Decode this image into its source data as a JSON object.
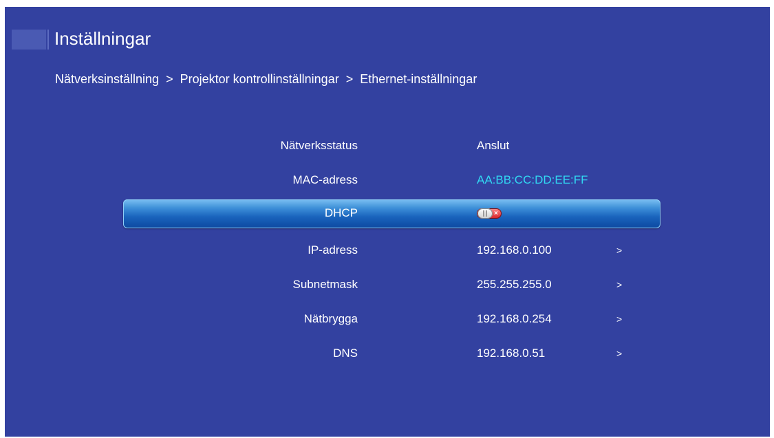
{
  "header": {
    "title": "Inställningar",
    "logo_icon": "app-logo-icon"
  },
  "breadcrumb": {
    "items": [
      "Nätverksinställning",
      "Projektor kontrollinställningar",
      "Ethernet-inställningar"
    ],
    "separator": ">"
  },
  "settings": {
    "network_status": {
      "label": "Nätverksstatus",
      "value": "Anslut"
    },
    "mac_address": {
      "label": "MAC-adress",
      "value": "AA:BB:CC:DD:EE:FF"
    },
    "dhcp": {
      "label": "DHCP",
      "state": "off",
      "toggle_off_glyph": "×"
    },
    "ip_address": {
      "label": "IP-adress",
      "value": "192.168.0.100",
      "arrow": ">"
    },
    "subnet_mask": {
      "label": "Subnetmask",
      "value": "255.255.255.0",
      "arrow": ">"
    },
    "gateway": {
      "label": "Nätbrygga",
      "value": "192.168.0.254",
      "arrow": ">"
    },
    "dns": {
      "label": "DNS",
      "value": "192.168.0.51",
      "arrow": ">"
    }
  },
  "colors": {
    "background": "#3341a0",
    "highlight": "#1a64bd",
    "mac_text": "#31d8f2",
    "toggle_off": "#d71f24"
  }
}
